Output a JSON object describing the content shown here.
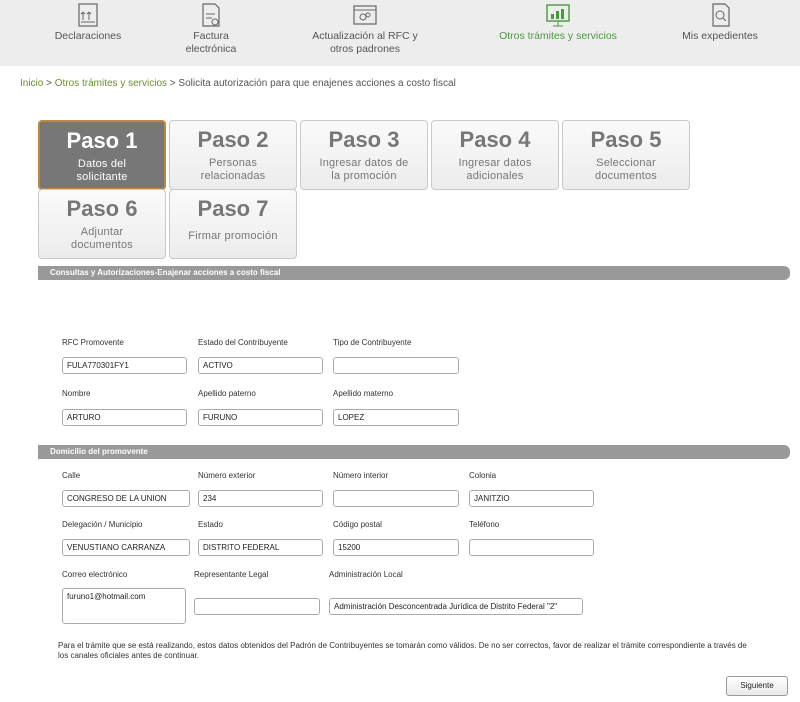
{
  "topnav": [
    {
      "label": "Declaraciones",
      "icon": "declaraciones-icon"
    },
    {
      "label": "Factura electrónica",
      "icon": "factura-icon"
    },
    {
      "label": "Actualización al RFC y otros padrones",
      "icon": "rfc-icon"
    },
    {
      "label": "Otros trámites y servicios",
      "icon": "tramites-icon"
    },
    {
      "label": "Mis expedientes",
      "icon": "expedientes-icon"
    }
  ],
  "breadcrumb": {
    "home": "Inicio",
    "sep1": " > ",
    "section": "Otros trámites y servicios",
    "sep2": " > ",
    "current": "Solicita autorización para que enajenes acciones a costo fiscal"
  },
  "steps": [
    {
      "num": "Paso 1",
      "desc": "Datos del solicitante",
      "active": true
    },
    {
      "num": "Paso 2",
      "desc": "Personas relacionadas"
    },
    {
      "num": "Paso 3",
      "desc": "Ingresar datos de la promoción"
    },
    {
      "num": "Paso 4",
      "desc": "Ingresar datos adicionales"
    },
    {
      "num": "Paso 5",
      "desc": "Seleccionar documentos"
    },
    {
      "num": "Paso 6",
      "desc": "Adjuntar documentos"
    },
    {
      "num": "Paso 7",
      "desc": "Firmar promoción"
    }
  ],
  "section1": {
    "title": "Consultas y Autorizaciones-Enajenar acciones a costo fiscal",
    "fields": {
      "rfc": {
        "label": "RFC Promovente",
        "value": "FULA770301FY1"
      },
      "estado_contrib": {
        "label": "Estado del Contribuyente",
        "value": "ACTIVO"
      },
      "tipo_contrib": {
        "label": "Tipo de Contribuyente",
        "value": ""
      },
      "nombre": {
        "label": "Nombre",
        "value": "ARTURO"
      },
      "ap_paterno": {
        "label": "Apellido paterno",
        "value": "FURUNO"
      },
      "ap_materno": {
        "label": "Apellido materno",
        "value": "LOPEZ"
      }
    }
  },
  "section2": {
    "title": "Domicilio del promovente",
    "fields": {
      "calle": {
        "label": "Calle",
        "value": "CONGRESO DE LA UNION"
      },
      "num_ext": {
        "label": "Número exterior",
        "value": "234"
      },
      "num_int": {
        "label": "Número interior",
        "value": ""
      },
      "colonia": {
        "label": "Colonia",
        "value": "JANITZIO"
      },
      "delegacion": {
        "label": "Delegación / Municipio",
        "value": "VENUSTIANO CARRANZA"
      },
      "estado": {
        "label": "Estado",
        "value": "DISTRITO FEDERAL"
      },
      "cp": {
        "label": "Código postal",
        "value": "15200"
      },
      "telefono": {
        "label": "Teléfono",
        "value": ""
      },
      "correo": {
        "label": "Correo electrónico",
        "value": "furuno1@hotmail.com"
      },
      "representante": {
        "label": "Representante Legal",
        "value": ""
      },
      "administracion": {
        "label": "Administración Local",
        "value": "Administración Desconcentrada Jurídica de Distrito Federal \"2\""
      }
    }
  },
  "note": "Para el trámite que se está realizando, estos datos obtenidos del Padrón de Contribuyentes se tomarán como válidos. De no ser correctos, favor de realizar el trámite correspondiente a través de los canales oficiales antes de continuar.",
  "next_button": "Siguiente",
  "colors": {
    "accent": "#4a9a3e",
    "section_bar": "#999999",
    "active_step": "#777777"
  }
}
